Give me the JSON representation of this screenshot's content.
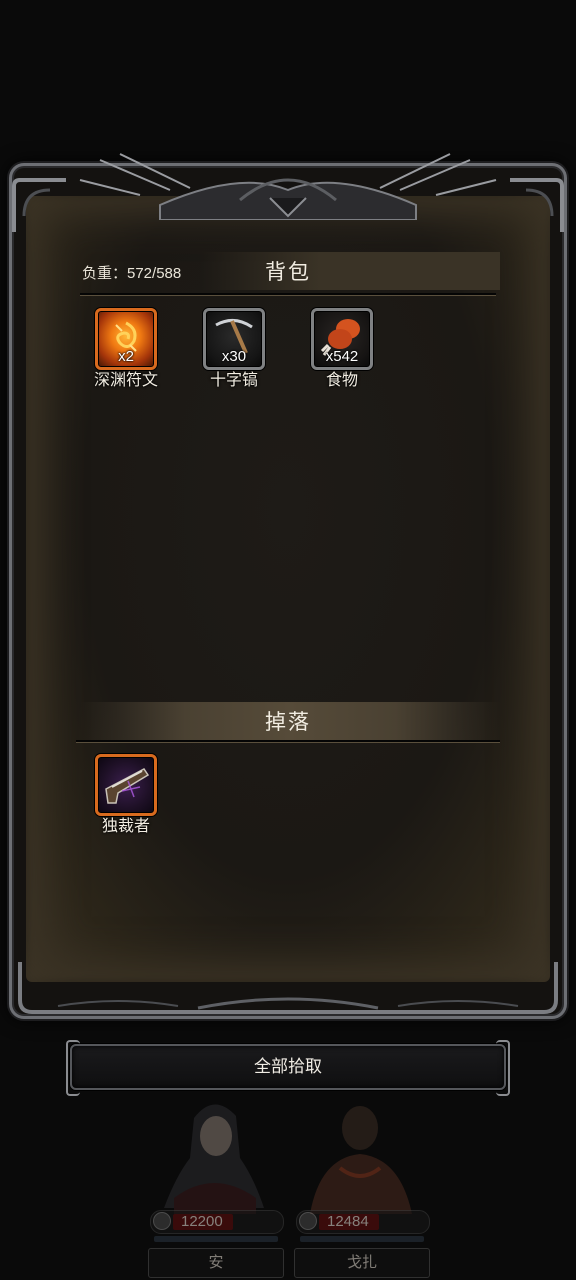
{
  "bag": {
    "title": "背包",
    "weight_label": "负重：572/588",
    "items": [
      {
        "name": "深渊符文",
        "qty": "x2",
        "icon": "abyss-rune-icon",
        "rarity_color": "#d86a1e"
      },
      {
        "name": "十字镐",
        "qty": "x30",
        "icon": "pickaxe-icon",
        "rarity_color": "#7f8183"
      },
      {
        "name": "食物",
        "qty": "x542",
        "icon": "food-drumstick-icon",
        "rarity_color": "#7f8183"
      }
    ]
  },
  "drops": {
    "title": "掉落",
    "items": [
      {
        "name": "独裁者",
        "icon": "dictator-pistol-icon",
        "rarity_color": "#d86a1e"
      }
    ]
  },
  "pickup_all_label": "全部拾取",
  "party": [
    {
      "name": "安",
      "hp": "12200",
      "hp_fraction": 0.55
    },
    {
      "name": "戈扎",
      "hp": "12484",
      "hp_fraction": 0.55
    }
  ]
}
